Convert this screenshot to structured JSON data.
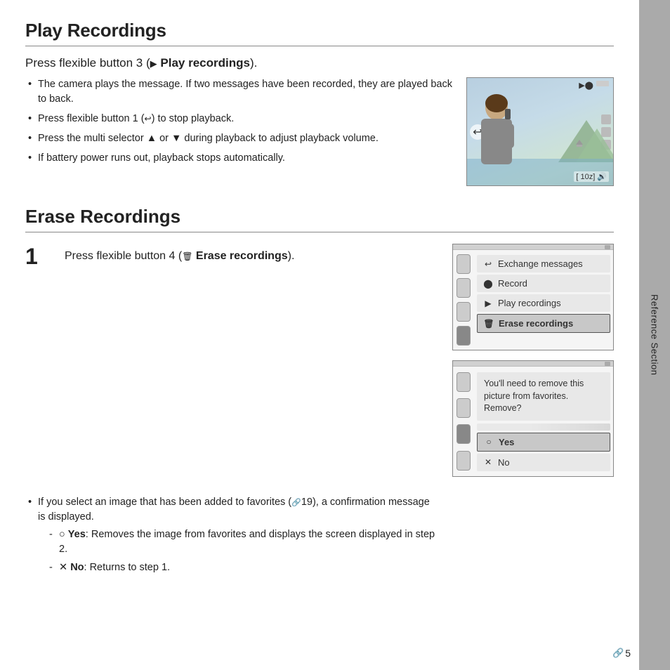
{
  "page": {
    "title": "Play Recordings",
    "side_tab": "Reference Section",
    "page_number": "5"
  },
  "play_section": {
    "heading": "Press flexible button 3 (",
    "heading_icon": "▶",
    "heading_bold": "Play recordings",
    "heading_end": ").",
    "bullets": [
      "The camera plays the message. If two messages have been recorded, they are played back to back.",
      "Press flexible button 1 (↩) to stop playback.",
      "Press the multi selector ▲ or ▼ during playback to adjust playback volume.",
      "If battery power runs out, playback stops automatically."
    ]
  },
  "erase_section": {
    "title": "Erase Recordings",
    "step1": {
      "number": "1",
      "text_pre": "Press flexible button 4 (",
      "icon_label": "🗑",
      "text_bold": "Erase recordings",
      "text_end": ")."
    },
    "panel1": {
      "top_bar": true,
      "menu_items": [
        {
          "label": "Exchange messages",
          "icon": "↩",
          "selected": false
        },
        {
          "label": "Record",
          "icon": "⬤",
          "selected": false
        },
        {
          "label": "Play recordings",
          "icon": "▶",
          "selected": false
        },
        {
          "label": "Erase recordings",
          "icon": "🗑",
          "selected": true
        }
      ]
    },
    "panel2": {
      "confirm_text": "You'll need to remove this picture from favorites. Remove?",
      "menu_items": [
        {
          "label": "Yes",
          "icon": "○",
          "selected": true
        },
        {
          "label": "No",
          "icon": "✕",
          "selected": false
        }
      ]
    },
    "bullets": [
      {
        "text": "If you select an image that has been added to favorites (🔗19), a confirmation message is displayed.",
        "sub_items": [
          {
            "bold": "Yes",
            "bold_prefix": "○ ",
            "rest": ": Removes the image from favorites and displays the screen displayed in step 2."
          },
          {
            "bold": "No",
            "bold_prefix": "✕ ",
            "rest": ": Returns to step 1."
          }
        ]
      }
    ]
  }
}
